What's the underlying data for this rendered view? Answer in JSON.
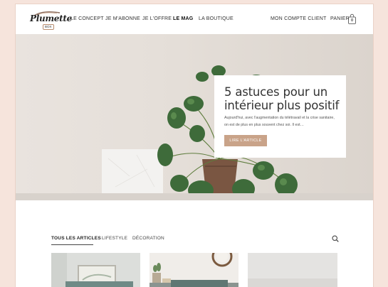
{
  "brand": {
    "name": "Plumette",
    "subtitle": "BOX"
  },
  "nav": {
    "items": [
      {
        "label": "LE CONCEPT"
      },
      {
        "label": "JE M'ABONNE"
      },
      {
        "label": "JE L'OFFRE"
      },
      {
        "label": "LE MAG",
        "active": true
      },
      {
        "label": "LA BOUTIQUE"
      }
    ],
    "account": "MON COMPTE CLIENT",
    "cart": "PANIER",
    "cart_count": "0"
  },
  "hero": {
    "title": "5 astuces pour un intérieur plus positif",
    "excerpt": "Aujourd'hui, avec l'augmentation du télétravail et la crise sanitaire, on est de plus en plus souvent chez soi. Il est…",
    "button": "LIRE L'ARTICLE"
  },
  "filters": {
    "tabs": [
      {
        "label": "TOUS LES ARTICLES",
        "active": true
      },
      {
        "label": "LIFESTYLE"
      },
      {
        "label": "DÉCORATION"
      }
    ]
  },
  "icons": {
    "search": "search-icon",
    "cart": "shopping-bag-icon"
  },
  "colors": {
    "accent": "#c9a389",
    "page_bg": "#f6e4dc",
    "text": "#333333"
  }
}
